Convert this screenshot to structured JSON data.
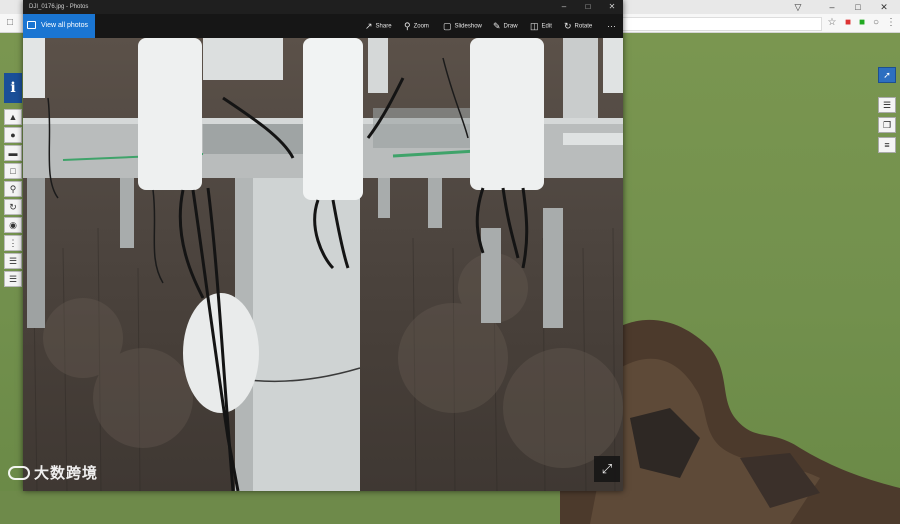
{
  "photos_window": {
    "title": "DJI_0176.jpg - Photos",
    "view_all_label": "View all photos",
    "commands": [
      {
        "label": "Share",
        "icon": "share-icon"
      },
      {
        "label": "Zoom",
        "icon": "zoom-icon"
      },
      {
        "label": "Slideshow",
        "icon": "slideshow-icon"
      },
      {
        "label": "Draw",
        "icon": "draw-icon"
      },
      {
        "label": "Edit",
        "icon": "edit-icon"
      },
      {
        "label": "Rotate",
        "icon": "rotate-icon"
      }
    ],
    "more_label": "···",
    "accent_color": "#1a75d2"
  },
  "watermark": {
    "text": "大数跨境"
  }
}
